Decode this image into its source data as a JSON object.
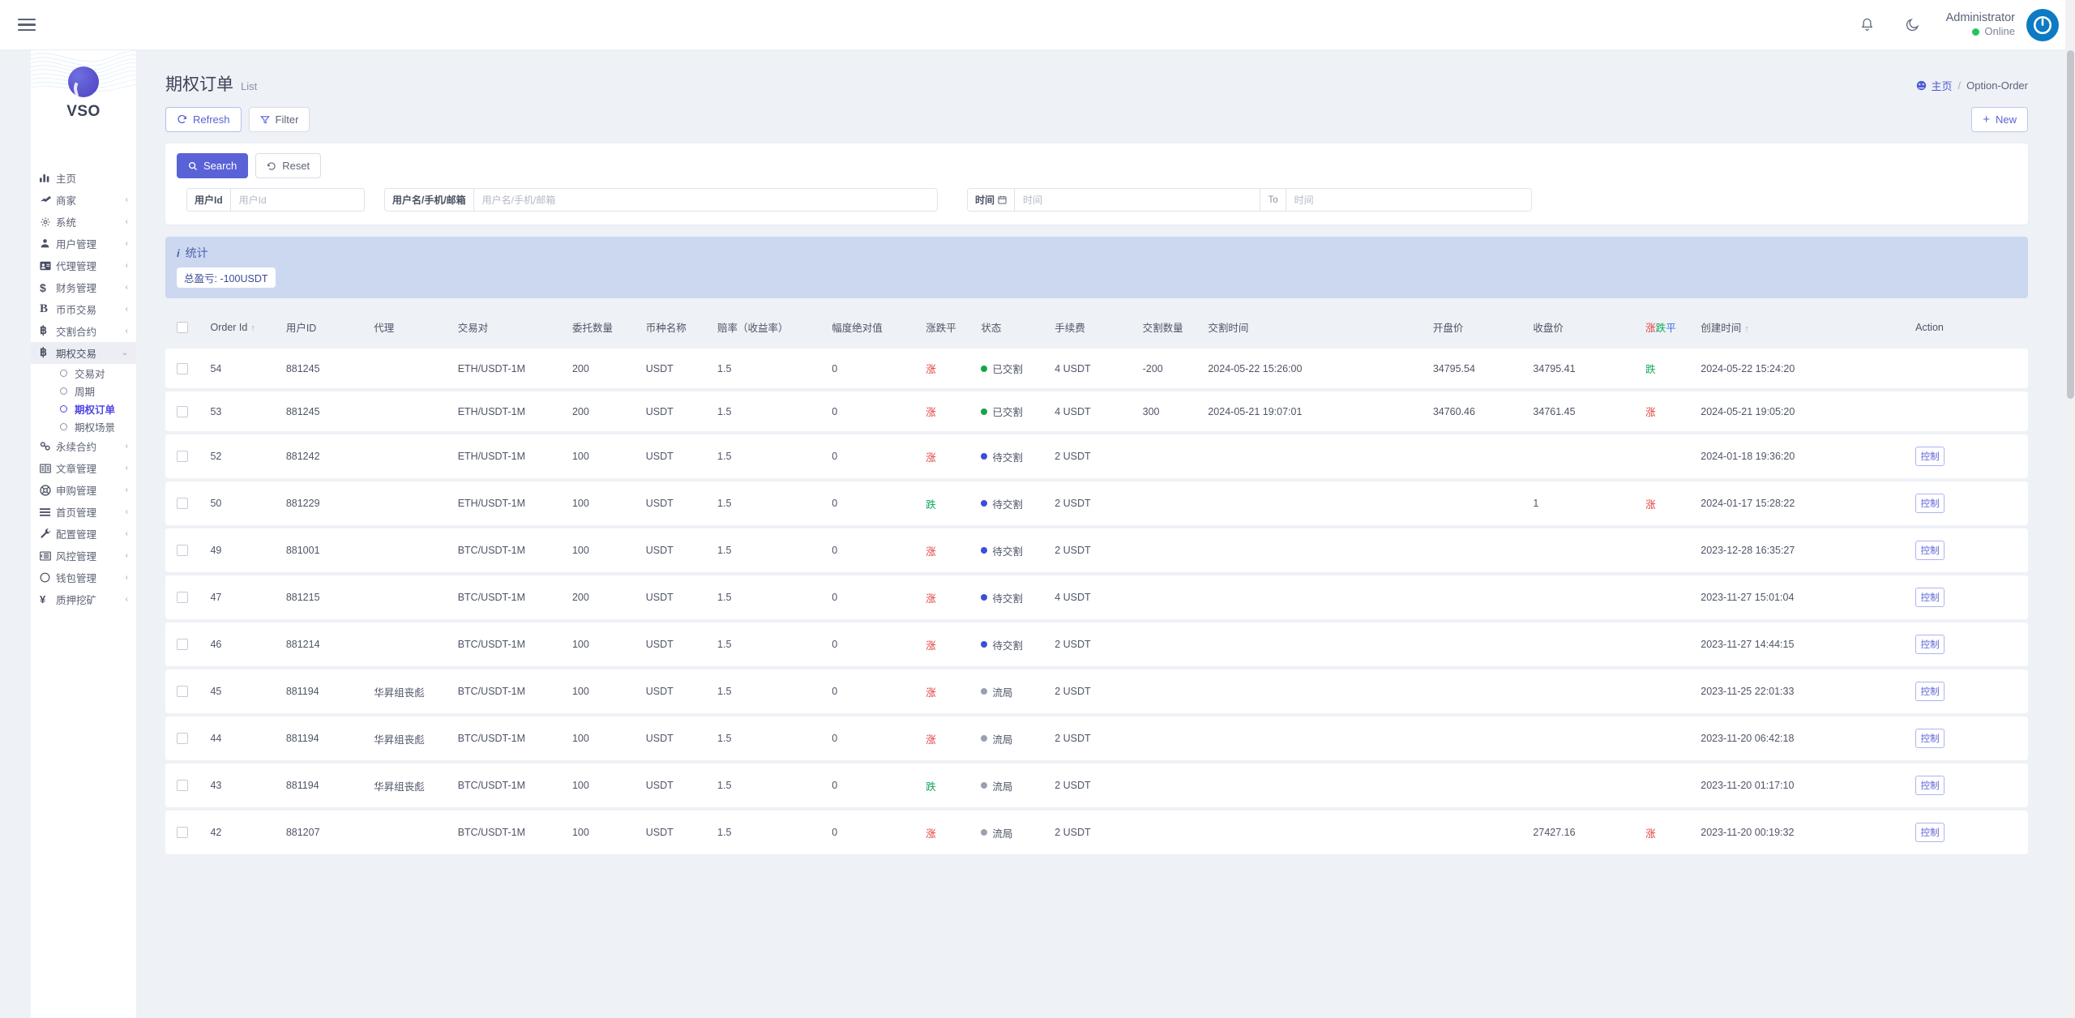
{
  "topbar": {
    "menu_toggle": "hamburger-menu",
    "notification_icon": "bell-icon",
    "theme_icon": "moon-icon",
    "user_name": "Administrator",
    "user_status": "Online"
  },
  "sidebar": {
    "brand": "VSO",
    "items": [
      {
        "label": "主页",
        "icon": "chart-bars-icon",
        "arrow": "",
        "active": false
      },
      {
        "label": "商家",
        "icon": "merchant-icon",
        "arrow": "‹",
        "active": false
      },
      {
        "label": "系统",
        "icon": "gear-icon",
        "arrow": "‹",
        "active": false
      },
      {
        "label": "用户管理",
        "icon": "user-icon",
        "arrow": "‹",
        "active": false
      },
      {
        "label": "代理管理",
        "icon": "id-card-icon",
        "arrow": "‹",
        "active": false
      },
      {
        "label": "财务管理",
        "icon": "dollar-icon",
        "arrow": "‹",
        "active": false
      },
      {
        "label": "币币交易",
        "icon": "letter-b-icon",
        "arrow": "‹",
        "active": false
      },
      {
        "label": "交割合约",
        "icon": "bitcoin-icon",
        "arrow": "‹",
        "active": false
      },
      {
        "label": "期权交易",
        "icon": "bitcoin-icon",
        "arrow": "⌄",
        "active": true
      }
    ],
    "submenu": [
      {
        "label": "交易对",
        "current": false
      },
      {
        "label": "周期",
        "current": false
      },
      {
        "label": "期权订单",
        "current": true
      },
      {
        "label": "期权场景",
        "current": false
      }
    ],
    "items_after": [
      {
        "label": "永续合约",
        "icon": "link-icon",
        "arrow": "‹"
      },
      {
        "label": "文章管理",
        "icon": "article-icon",
        "arrow": "‹"
      },
      {
        "label": "申购管理",
        "icon": "lifebuoy-icon",
        "arrow": "‹"
      },
      {
        "label": "首页管理",
        "icon": "list-icon",
        "arrow": "‹"
      },
      {
        "label": "配置管理",
        "icon": "wrench-icon",
        "arrow": "‹"
      },
      {
        "label": "风控管理",
        "icon": "risk-icon",
        "arrow": "‹"
      },
      {
        "label": "钱包管理",
        "icon": "circle-icon",
        "arrow": "‹"
      },
      {
        "label": "质押挖矿",
        "icon": "yen-icon",
        "arrow": "‹"
      }
    ]
  },
  "page": {
    "title": "期权订单",
    "subtitle": "List",
    "breadcrumb_home": "主页",
    "breadcrumb_sep": "/",
    "breadcrumb_current": "Option-Order"
  },
  "toolbar": {
    "refresh": "Refresh",
    "filter": "Filter",
    "new": "New"
  },
  "search": {
    "search_btn": "Search",
    "reset_btn": "Reset",
    "user_id_label": "用户Id",
    "user_id_placeholder": "用户Id",
    "user_name_label": "用户名/手机/邮箱",
    "user_name_placeholder": "用户名/手机/邮箱",
    "time_label": "时间",
    "time_from_placeholder": "时间",
    "time_to": "To",
    "time_to_placeholder": "时间"
  },
  "stats": {
    "title": "统计",
    "chip": "总盈亏: -100USDT"
  },
  "table": {
    "columns": [
      "Order Id",
      "用户ID",
      "代理",
      "交易对",
      "委托数量",
      "币种名称",
      "赔率（收益率）",
      "幅度绝对值",
      "涨跌平",
      "状态",
      "手续费",
      "交割数量",
      "交割时间",
      "开盘价",
      "收盘价",
      "涨跌平",
      "创建时间",
      "Action"
    ],
    "column_colored_index": 15,
    "colored_header_parts": [
      {
        "text": "涨",
        "color": "#e23b3b"
      },
      {
        "text": "跌",
        "color": "#13a65c"
      },
      {
        "text": "平",
        "color": "#3b6fe2"
      }
    ],
    "sort_asc_icon": "↑",
    "action_label": "控制",
    "rows": [
      {
        "order_id": "54",
        "user_id": "881245",
        "agent": "",
        "pair": "ETH/USDT-1M",
        "amount": "200",
        "coin": "USDT",
        "odds": "1.5",
        "abs_range": "0",
        "direction": "涨",
        "direction_kind": "up",
        "status": "已交割",
        "status_kind": "green",
        "fee": "4 USDT",
        "settle_amount": "-200",
        "settle_time": "2024-05-22 15:26:00",
        "open_price": "34795.54",
        "close_price": "34795.41",
        "result": "跌",
        "result_kind": "down",
        "created": "2024-05-22 15:24:20",
        "action": ""
      },
      {
        "order_id": "53",
        "user_id": "881245",
        "agent": "",
        "pair": "ETH/USDT-1M",
        "amount": "200",
        "coin": "USDT",
        "odds": "1.5",
        "abs_range": "0",
        "direction": "涨",
        "direction_kind": "up",
        "status": "已交割",
        "status_kind": "green",
        "fee": "4 USDT",
        "settle_amount": "300",
        "settle_time": "2024-05-21 19:07:01",
        "open_price": "34760.46",
        "close_price": "34761.45",
        "result": "涨",
        "result_kind": "up",
        "created": "2024-05-21 19:05:20",
        "action": ""
      },
      {
        "order_id": "52",
        "user_id": "881242",
        "agent": "",
        "pair": "ETH/USDT-1M",
        "amount": "100",
        "coin": "USDT",
        "odds": "1.5",
        "abs_range": "0",
        "direction": "涨",
        "direction_kind": "up",
        "status": "待交割",
        "status_kind": "blue",
        "fee": "2 USDT",
        "settle_amount": "",
        "settle_time": "",
        "open_price": "",
        "close_price": "",
        "result": "",
        "result_kind": "",
        "created": "2024-01-18 19:36:20",
        "action": "控制"
      },
      {
        "order_id": "50",
        "user_id": "881229",
        "agent": "",
        "pair": "ETH/USDT-1M",
        "amount": "100",
        "coin": "USDT",
        "odds": "1.5",
        "abs_range": "0",
        "direction": "跌",
        "direction_kind": "down",
        "status": "待交割",
        "status_kind": "blue",
        "fee": "2 USDT",
        "settle_amount": "",
        "settle_time": "",
        "open_price": "",
        "close_price": "1",
        "result": "涨",
        "result_kind": "up",
        "created": "2024-01-17 15:28:22",
        "action": "控制"
      },
      {
        "order_id": "49",
        "user_id": "881001",
        "agent": "",
        "pair": "BTC/USDT-1M",
        "amount": "100",
        "coin": "USDT",
        "odds": "1.5",
        "abs_range": "0",
        "direction": "涨",
        "direction_kind": "up",
        "status": "待交割",
        "status_kind": "blue",
        "fee": "2 USDT",
        "settle_amount": "",
        "settle_time": "",
        "open_price": "",
        "close_price": "",
        "result": "",
        "result_kind": "",
        "created": "2023-12-28 16:35:27",
        "action": "控制"
      },
      {
        "order_id": "47",
        "user_id": "881215",
        "agent": "",
        "pair": "BTC/USDT-1M",
        "amount": "200",
        "coin": "USDT",
        "odds": "1.5",
        "abs_range": "0",
        "direction": "涨",
        "direction_kind": "up",
        "status": "待交割",
        "status_kind": "blue",
        "fee": "4 USDT",
        "settle_amount": "",
        "settle_time": "",
        "open_price": "",
        "close_price": "",
        "result": "",
        "result_kind": "",
        "created": "2023-11-27 15:01:04",
        "action": "控制"
      },
      {
        "order_id": "46",
        "user_id": "881214",
        "agent": "",
        "pair": "BTC/USDT-1M",
        "amount": "100",
        "coin": "USDT",
        "odds": "1.5",
        "abs_range": "0",
        "direction": "涨",
        "direction_kind": "up",
        "status": "待交割",
        "status_kind": "blue",
        "fee": "2 USDT",
        "settle_amount": "",
        "settle_time": "",
        "open_price": "",
        "close_price": "",
        "result": "",
        "result_kind": "",
        "created": "2023-11-27 14:44:15",
        "action": "控制"
      },
      {
        "order_id": "45",
        "user_id": "881194",
        "agent": "华昇组丧彪",
        "pair": "BTC/USDT-1M",
        "amount": "100",
        "coin": "USDT",
        "odds": "1.5",
        "abs_range": "0",
        "direction": "涨",
        "direction_kind": "up",
        "status": "流局",
        "status_kind": "gray",
        "fee": "2 USDT",
        "settle_amount": "",
        "settle_time": "",
        "open_price": "",
        "close_price": "",
        "result": "",
        "result_kind": "",
        "created": "2023-11-25 22:01:33",
        "action": "控制"
      },
      {
        "order_id": "44",
        "user_id": "881194",
        "agent": "华昇组丧彪",
        "pair": "BTC/USDT-1M",
        "amount": "100",
        "coin": "USDT",
        "odds": "1.5",
        "abs_range": "0",
        "direction": "涨",
        "direction_kind": "up",
        "status": "流局",
        "status_kind": "gray",
        "fee": "2 USDT",
        "settle_amount": "",
        "settle_time": "",
        "open_price": "",
        "close_price": "",
        "result": "",
        "result_kind": "",
        "created": "2023-11-20 06:42:18",
        "action": "控制"
      },
      {
        "order_id": "43",
        "user_id": "881194",
        "agent": "华昇组丧彪",
        "pair": "BTC/USDT-1M",
        "amount": "100",
        "coin": "USDT",
        "odds": "1.5",
        "abs_range": "0",
        "direction": "跌",
        "direction_kind": "down",
        "status": "流局",
        "status_kind": "gray",
        "fee": "2 USDT",
        "settle_amount": "",
        "settle_time": "",
        "open_price": "",
        "close_price": "",
        "result": "",
        "result_kind": "",
        "created": "2023-11-20 01:17:10",
        "action": "控制"
      },
      {
        "order_id": "42",
        "user_id": "881207",
        "agent": "",
        "pair": "BTC/USDT-1M",
        "amount": "100",
        "coin": "USDT",
        "odds": "1.5",
        "abs_range": "0",
        "direction": "涨",
        "direction_kind": "up",
        "status": "流局",
        "status_kind": "gray",
        "fee": "2 USDT",
        "settle_amount": "",
        "settle_time": "",
        "open_price": "",
        "close_price": "27427.16",
        "result": "涨",
        "result_kind": "up",
        "created": "2023-11-20 00:19:32",
        "action": "控制"
      }
    ]
  },
  "colors": {
    "primary": "#5a62d8",
    "up": "#e23b3b",
    "down": "#13a65c",
    "flat": "#3b6fe2",
    "stats_bg": "#ccd8f0"
  }
}
